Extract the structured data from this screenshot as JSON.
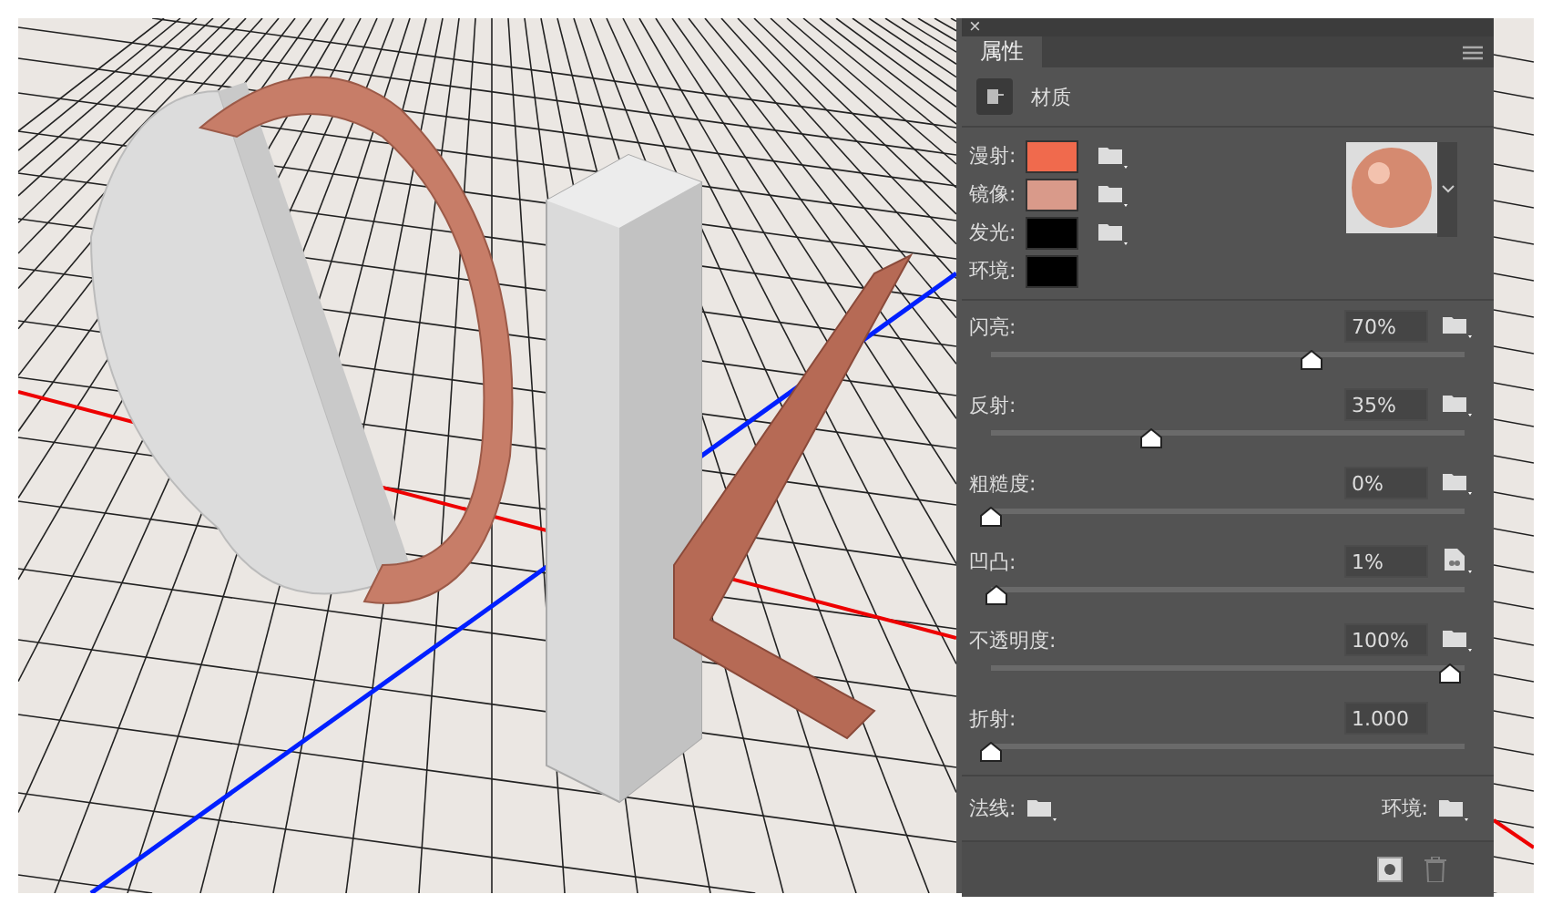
{
  "panel": {
    "close": "×",
    "tab": "属性",
    "section": "材质",
    "colors": [
      {
        "label": "漫射:",
        "color": "#f06a4d",
        "folder": true
      },
      {
        "label": "镜像:",
        "color": "#d99a8a",
        "folder": true
      },
      {
        "label": "发光:",
        "color": "#000000",
        "folder": true
      },
      {
        "label": "环境:",
        "color": "#000000",
        "folder": false
      }
    ],
    "sliders": [
      {
        "label": "闪亮:",
        "value": "70%",
        "level": 0.7,
        "kind": "folder"
      },
      {
        "label": "反射:",
        "value": "35%",
        "level": 0.35,
        "kind": "folder"
      },
      {
        "label": "粗糙度:",
        "value": "0%",
        "level": 0,
        "kind": "folder"
      },
      {
        "label": "凹凸:",
        "value": "1%",
        "level": 0.01,
        "kind": "texture"
      },
      {
        "label": "不透明度:",
        "value": "100%",
        "level": 1,
        "kind": "folder"
      },
      {
        "label": "折射:",
        "value": "1.000",
        "level": 0,
        "kind": "none"
      }
    ],
    "maps": [
      {
        "label": "法线:"
      },
      {
        "label": "环境:"
      }
    ],
    "delete_disabled": true
  }
}
